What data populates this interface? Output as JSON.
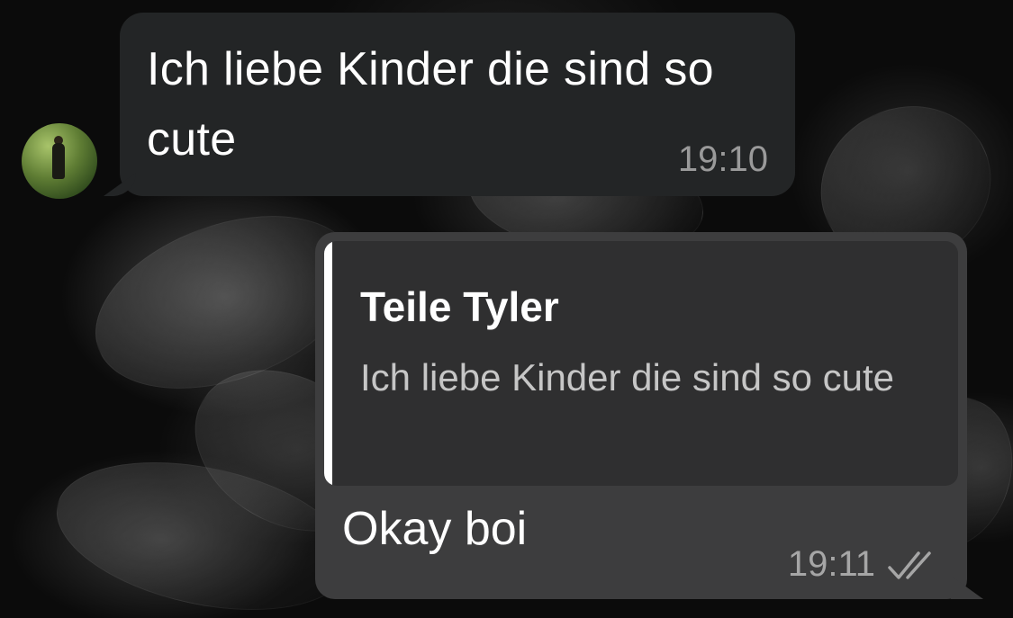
{
  "incoming_message": {
    "text": "Ich liebe Kinder die sind so cute",
    "time": "19:10"
  },
  "outgoing_message": {
    "reply_to": {
      "author": "Teile Tyler",
      "text": "Ich liebe Kinder die sind so cute"
    },
    "text": "Okay boi",
    "time": "19:11",
    "status_icon": "double-check-icon"
  },
  "colors": {
    "incoming_bubble": "#232526",
    "outgoing_bubble": "#3d3d3e",
    "quote_bar": "#ffffff"
  }
}
